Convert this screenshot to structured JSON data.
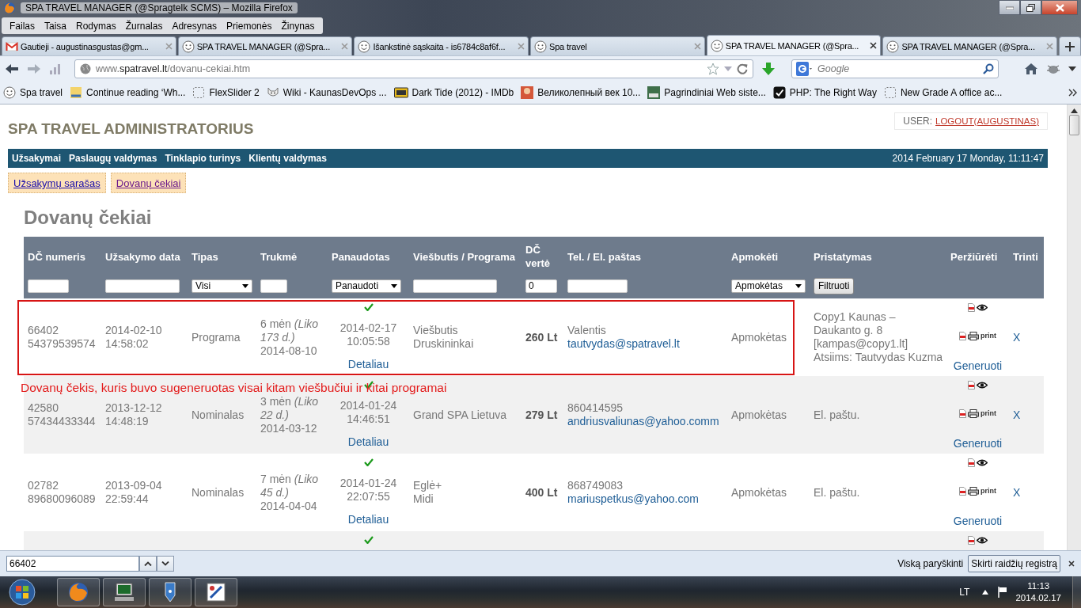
{
  "window": {
    "title": "SPA TRAVEL MANAGER (@Spragtelk SCMS) – Mozilla Firefox"
  },
  "menu": [
    "Failas",
    "Taisa",
    "Rodymas",
    "Žurnalas",
    "Adresynas",
    "Priemonės",
    "Žinynas"
  ],
  "tabs": [
    {
      "label": "Gautieji - augustinasgustas@gm...",
      "kind": "mail",
      "selected": false
    },
    {
      "label": "SPA TRAVEL MANAGER (@Spra...",
      "kind": "smiley",
      "selected": false
    },
    {
      "label": "Išankstinė sąskaita - is6784c8af6f...",
      "kind": "smiley",
      "selected": false
    },
    {
      "label": "Spa travel",
      "kind": "smiley",
      "selected": false
    },
    {
      "label": "SPA TRAVEL MANAGER (@Spra...",
      "kind": "smiley",
      "selected": true
    },
    {
      "label": "SPA TRAVEL MANAGER (@Spra...",
      "kind": "smiley",
      "selected": false
    }
  ],
  "address_bar": {
    "prefix": "www.",
    "domain": "spatravel.lt",
    "path": "/dovanu-cekiai.htm"
  },
  "search": {
    "placeholder": "Google"
  },
  "bookmarks": [
    {
      "label": "Spa travel",
      "kind": "smiley"
    },
    {
      "label": "Continue reading ‘Wh...",
      "kind": "logo"
    },
    {
      "label": "FlexSlider 2",
      "kind": "dashed"
    },
    {
      "label": "Wiki - KaunasDevOps ...",
      "kind": "cat"
    },
    {
      "label": "Dark Tide (2012) - IMDb",
      "kind": "imdb"
    },
    {
      "label": "Великолепный век 10...",
      "kind": "photo"
    },
    {
      "label": "Pagrindiniai Web siste...",
      "kind": "cert"
    },
    {
      "label": "PHP: The Right Way",
      "kind": "check"
    },
    {
      "label": "New Grade A office ac...",
      "kind": "dashed"
    }
  ],
  "page": {
    "site_title": "SPA TRAVEL ADMINISTRATORIUS",
    "user_label": "USER:",
    "logout": "LOGOUT(AUGUSTINAS)",
    "nav": [
      "Užsakymai",
      "Paslaugų valdymas",
      "Tinklapio turinys",
      "Klientų valdymas"
    ],
    "datetime": "2014 February 17 Monday, 11:11:47",
    "subnav": [
      {
        "label": "Užsakymų sąrašas",
        "visited": false
      },
      {
        "label": "Dovanų čekiai",
        "visited": true
      }
    ],
    "heading": "Dovanų čekiai"
  },
  "table": {
    "columns": [
      "DČ numeris",
      "Užsakymo data",
      "Tipas",
      "Trukmė",
      "Panaudotas",
      "Viešbutis / Programa",
      "DČ vertė",
      "Tel. / El. paštas",
      "Apmokėti",
      "Pristatymas",
      "Peržiūrėti",
      "Trinti"
    ],
    "filters": [
      {
        "kind": "text"
      },
      {
        "kind": "text"
      },
      {
        "kind": "select",
        "value": "Visi"
      },
      {
        "kind": "text"
      },
      {
        "kind": "select",
        "value": "Panaudoti"
      },
      {
        "kind": "text"
      },
      {
        "kind": "text",
        "value": "0"
      },
      {
        "kind": "text"
      },
      {
        "kind": "select",
        "value": "Apmokėtas"
      },
      {
        "kind": "button",
        "label": "Filtruoti"
      }
    ],
    "rows": [
      {
        "number": "66402",
        "code": "54379539574",
        "date": "2014-02-10",
        "time": "14:58:02",
        "type": "Programa",
        "duration": "6 mėn *(Liko 173 d.)*",
        "end_date": "2014-08-10",
        "used": true,
        "used_date": "2014-02-17",
        "used_time": "10:05:58",
        "details": "Detaliau",
        "hotel": [
          "Viešbutis",
          "Druskininkai"
        ],
        "price": "260 Lt",
        "contact": "Valentis",
        "email": "tautvydas@spatravel.lt",
        "paid": "Apmokėtas",
        "delivery": [
          "Copy1 Kaunas –",
          "Daukanto g. 8",
          "[kampas@copy1.lt]",
          "Atsiims: Tautvydas Kuzma"
        ],
        "print": "print",
        "delete": "X",
        "generate": "Generuoti",
        "highlighted": true
      },
      {
        "number": "42580",
        "code": "57434433344",
        "date": "2013-12-12",
        "time": "14:48:19",
        "type": "Nominalas",
        "duration": "3 mėn *(Liko 22 d.)*",
        "end_date": "2014-03-12",
        "used": true,
        "used_date": "2014-01-24",
        "used_time": "14:46:51",
        "details": "Detaliau",
        "hotel": [
          "Grand SPA Lietuva"
        ],
        "price": "279 Lt",
        "contact": "860414595",
        "email": "andriusvaliunas@yahoo.comm",
        "paid": "Apmokėtas",
        "delivery": [
          "El. paštu."
        ],
        "print": "print",
        "delete": "X",
        "generate": "Generuoti"
      },
      {
        "number": "02782",
        "code": "89680096089",
        "date": "2013-09-04",
        "time": "22:59:44",
        "type": "Nominalas",
        "duration": "7 mėn *(Liko 45 d.)*",
        "end_date": "2014-04-04",
        "used": true,
        "used_date": "2014-01-24",
        "used_time": "22:07:55",
        "details": "Detaliau",
        "hotel": [
          "Eglė+",
          "Midi"
        ],
        "price": "400 Lt",
        "contact": "868749083",
        "email": "mariuspetkus@yahoo.com",
        "paid": "Apmokėtas",
        "delivery": [
          "El. paštu."
        ],
        "print": "print",
        "delete": "X",
        "generate": "Generuoti"
      },
      {
        "used": true
      }
    ],
    "annotation": "Dovanų čekis, kuris buvo sugeneruotas visai kitam viešbučiui ir kitai programai"
  },
  "find_bar": {
    "value": "66402",
    "highlight_all": "Viską paryškinti",
    "match_case": "Skirti raidžių registrą"
  },
  "taskbar": {
    "language": "LT",
    "time": "11:13",
    "date": "2014.02.17"
  }
}
